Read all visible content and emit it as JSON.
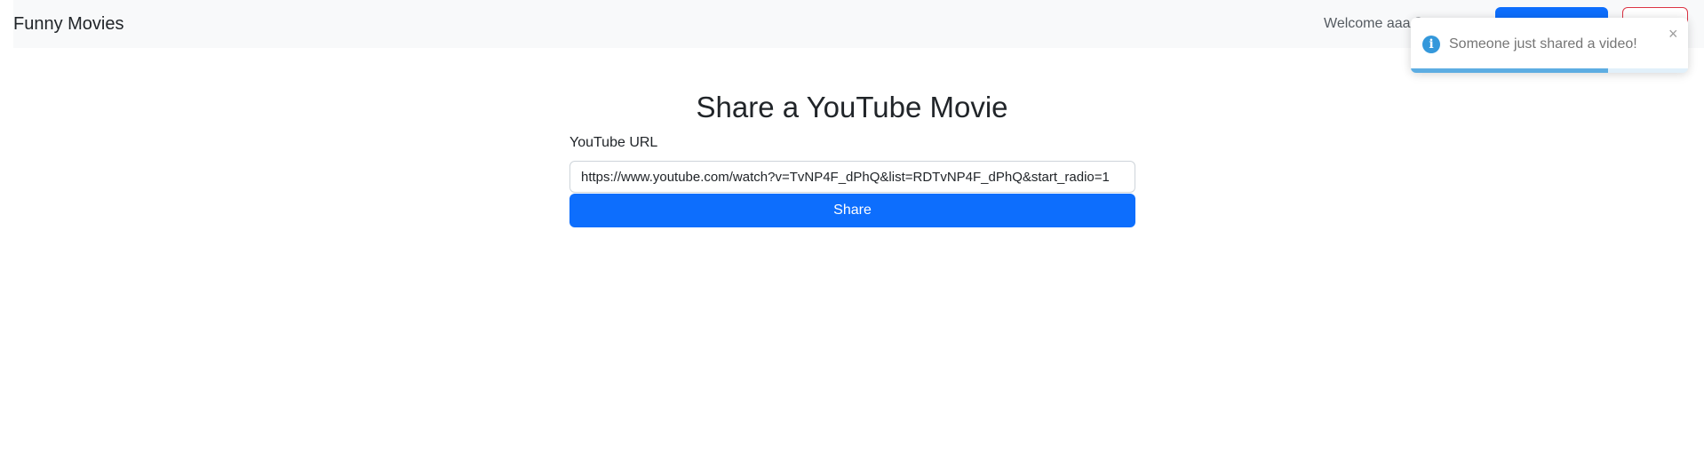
{
  "navbar": {
    "brand": "Funny Movies",
    "welcome_text": "Welcome aaa@",
    "primary_button_label": "",
    "danger_button_label": ""
  },
  "main": {
    "title": "Share a YouTube Movie",
    "url_label": "YouTube URL",
    "url_value": "https://www.youtube.com/watch?v=TvNP4F_dPhQ&list=RDTvNP4F_dPhQ&start_radio=1",
    "share_button_label": "Share"
  },
  "toast": {
    "icon": "info-icon",
    "message": "Someone just shared a video!",
    "close_glyph": "×",
    "progress_fraction": 0.71
  },
  "colors": {
    "primary": "#0d6efd",
    "danger": "#dc3545",
    "navbar_bg": "#f8f9fa",
    "toast_info": "#3498db"
  }
}
